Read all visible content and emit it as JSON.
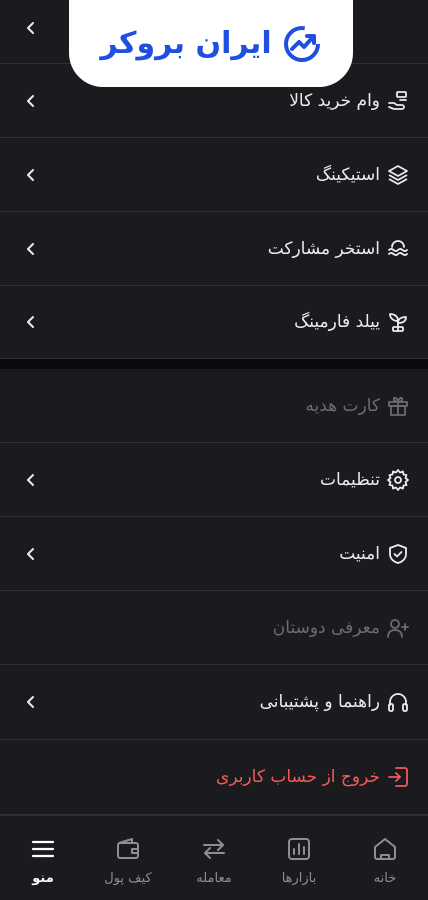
{
  "brand": {
    "logo_text": "ایران بروکر",
    "accent": "#1f4fe0"
  },
  "menu": {
    "items": [
      {
        "label": "وام خرید کالا",
        "icon": "hand-coins-icon",
        "enabled": true
      },
      {
        "label": "استیکینگ",
        "icon": "layers-icon",
        "enabled": true
      },
      {
        "label": "استخر مشارکت",
        "icon": "pool-waves-icon",
        "enabled": true
      },
      {
        "label": "ییلد فارمینگ",
        "icon": "sprout-icon",
        "enabled": true
      },
      {
        "label": "کارت هدیه",
        "icon": "gift-icon",
        "enabled": false
      },
      {
        "label": "تنظیمات",
        "icon": "gear-icon",
        "enabled": true
      },
      {
        "label": "امنیت",
        "icon": "shield-check-icon",
        "enabled": true
      },
      {
        "label": "معرفی دوستان",
        "icon": "user-plus-icon",
        "enabled": false
      },
      {
        "label": "راهنما و پشتیبانی",
        "icon": "headphones-icon",
        "enabled": true
      },
      {
        "label": "خروج از حساب کاربری",
        "icon": "logout-icon",
        "enabled": true,
        "danger_color": "#ef5a5a"
      }
    ]
  },
  "bottom_nav": {
    "items": [
      {
        "label": "خانه",
        "icon": "home-icon",
        "active": false
      },
      {
        "label": "بازارها",
        "icon": "chart-icon",
        "active": false
      },
      {
        "label": "معامله",
        "icon": "swap-icon",
        "active": false
      },
      {
        "label": "کیف پول",
        "icon": "wallet-icon",
        "active": false
      },
      {
        "label": "منو",
        "icon": "menu-icon",
        "active": true
      }
    ]
  }
}
